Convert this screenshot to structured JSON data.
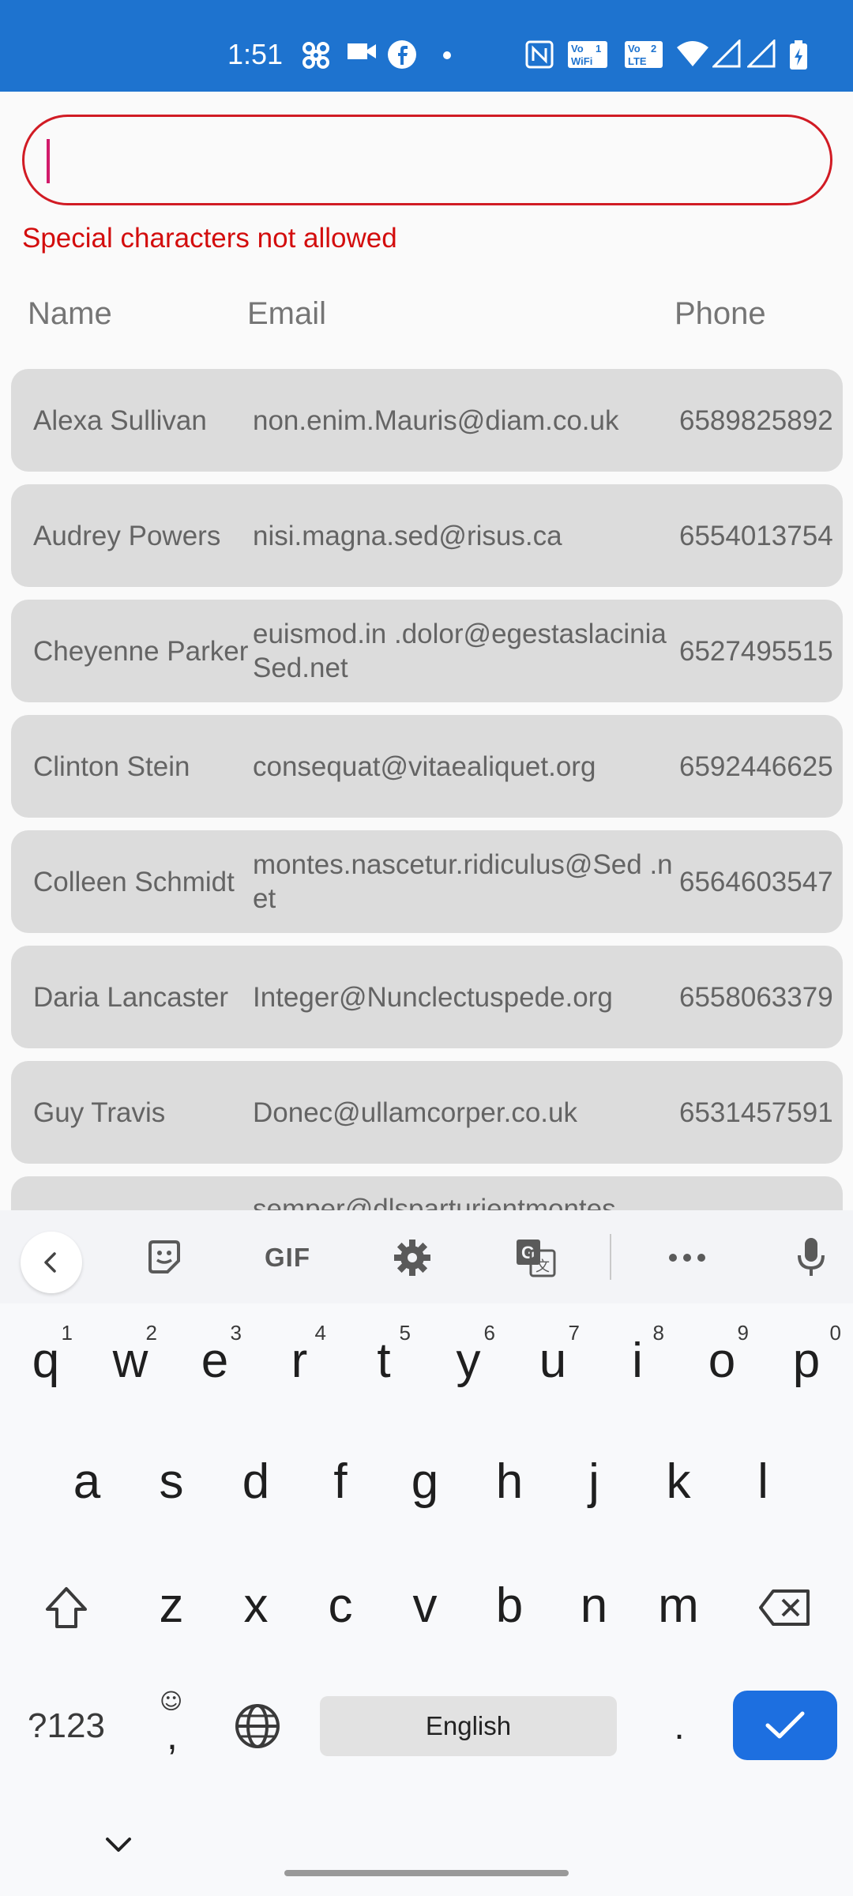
{
  "status_bar": {
    "time": "1:51",
    "icons": [
      "pinwheel-icon",
      "video-icon",
      "facebook-icon",
      "dot-icon",
      "nfc-icon",
      "vowifi-icon",
      "volte-icon",
      "wifi-icon",
      "signal-icon",
      "signal-icon",
      "battery-charging-icon"
    ],
    "background": "#1e73cf"
  },
  "search": {
    "value": "",
    "placeholder": "",
    "error": "Special characters not allowed",
    "error_color": "#d30d0d"
  },
  "table": {
    "headers": {
      "name": "Name",
      "email": "Email",
      "phone": "Phone"
    },
    "rows": [
      {
        "name": "Alexa Sullivan",
        "email": "non.enim.Mauris@diam.co.uk",
        "phone": "6589825892"
      },
      {
        "name": "Audrey Powers",
        "email": "nisi.magna.sed@risus.ca",
        "phone": "6554013754"
      },
      {
        "name": "Cheyenne Parker",
        "email": "euismod.in .dolor@egestaslaciniaSed.net",
        "phone": "6527495515"
      },
      {
        "name": "Clinton Stein",
        "email": "consequat@vitaealiquet.org",
        "phone": "6592446625"
      },
      {
        "name": "Colleen Schmidt",
        "email": "montes.nascetur.ridiculus@Sed .net",
        "phone": "6564603547"
      },
      {
        "name": "Daria Lancaster",
        "email": "Integer@Nunclectuspede.org",
        "phone": "6558063379"
      },
      {
        "name": "Guy Travis",
        "email": "Donec@ullamcorper.co.uk",
        "phone": "6531457591"
      },
      {
        "name": "",
        "email": "semper@dlsparturientmontes",
        "phone": ""
      }
    ]
  },
  "keyboard": {
    "toolbar": [
      "back-icon",
      "sticker-icon",
      "GIF",
      "settings-icon",
      "translate-icon",
      "more-icon",
      "mic-icon"
    ],
    "row1": [
      {
        "key": "q",
        "hint": "1"
      },
      {
        "key": "w",
        "hint": "2"
      },
      {
        "key": "e",
        "hint": "3"
      },
      {
        "key": "r",
        "hint": "4"
      },
      {
        "key": "t",
        "hint": "5"
      },
      {
        "key": "y",
        "hint": "6"
      },
      {
        "key": "u",
        "hint": "7"
      },
      {
        "key": "i",
        "hint": "8"
      },
      {
        "key": "o",
        "hint": "9"
      },
      {
        "key": "p",
        "hint": "0"
      }
    ],
    "row2": [
      "a",
      "s",
      "d",
      "f",
      "g",
      "h",
      "j",
      "k",
      "l"
    ],
    "row3": [
      "z",
      "x",
      "c",
      "v",
      "b",
      "n",
      "m"
    ],
    "symbols_label": "?123",
    "comma_label": ",",
    "space_label": "English",
    "period_label": ".",
    "accent": "#1d6fe0"
  }
}
